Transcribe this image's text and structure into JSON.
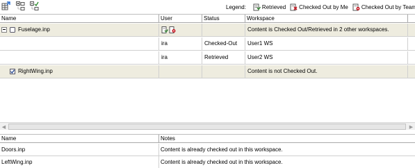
{
  "toolbar": {
    "buttons": [
      {
        "icon": "grid-refresh-icon"
      },
      {
        "icon": "expand-tree-icon"
      },
      {
        "icon": "collapse-tree-icon"
      }
    ],
    "legend_title": "Legend:",
    "legend": [
      {
        "label": "Retrieved",
        "icon": "retrieved-icon"
      },
      {
        "label": "Checked Out by Me",
        "icon": "checked-out-by-me-icon"
      },
      {
        "label": "Checked Out by Team",
        "icon": "checked-out-by-team-icon"
      }
    ]
  },
  "workspace_grid": {
    "columns": [
      "Name",
      "User",
      "Status",
      "Workspace"
    ],
    "rows": [
      {
        "name": "Fuselage.inp",
        "user": "",
        "status": "",
        "workspace": "Content is Checked Out/Retrieved in 2 other workspaces."
      },
      {
        "name": "",
        "user": "ira",
        "status": "Checked-Out",
        "workspace": "User1 WS"
      },
      {
        "name": "",
        "user": "ira",
        "status": "Retrieved",
        "workspace": "User2 WS"
      },
      {
        "name": "RightWing.inp",
        "user": "",
        "status": "",
        "workspace": "Content is not Checked Out."
      }
    ]
  },
  "notes_grid": {
    "columns": [
      "Name",
      "Notes"
    ],
    "rows": [
      {
        "name": "Doors.inp",
        "notes": "Content is already checked out in this workspace."
      },
      {
        "name": "LeftWing.inp",
        "notes": "Content is already checked out in this workspace."
      }
    ]
  },
  "colors": {
    "parent_row_bg": "#eeecdf",
    "checkout_red": "#c8202a",
    "retrieved_green": "#3b8a3b"
  }
}
